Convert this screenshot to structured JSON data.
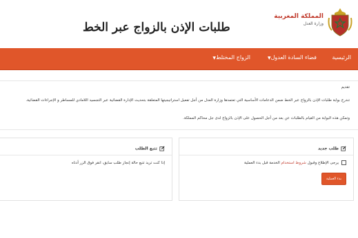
{
  "header": {
    "emblem_icon": "royal-emblem-icon",
    "kingdom_name": "المملكة المغربية",
    "ministry_name": "وزارة العدل",
    "site_title": "طلبات الإذن بالزواج عبر الخط"
  },
  "nav": {
    "color": "#e0562a",
    "items": [
      {
        "label": "الرئيسية",
        "has_dropdown": false
      },
      {
        "label": "فضاء السادة العدول",
        "has_dropdown": true
      },
      {
        "label": "الزواج المختلط",
        "has_dropdown": true
      }
    ]
  },
  "intro": {
    "heading": "تقديم",
    "paragraph1": "تندرج بوابة طلبات الإذن بالزواج عبر الخط ضمن الدعامات الأساسية التي تعتمدها وزارة العدل من أجل تفعيل استراتيجيتها المتعلقة بتحديث الإدارة القضائية عبر التجسيد اللامادي للمساطر و الإجراءات القضائية.",
    "paragraph2": "وتمكن هذه البوابة من القيام بالطلبات عن بعد من أجل الحصول على الإذن بالزواج لدى جل محاكم المملكة."
  },
  "new_request": {
    "title": "طلب جديد",
    "title_icon": "edit-icon",
    "checkbox_prefix": "يرجى الإطلاع وقبول",
    "checkbox_link": "شروط استخدام",
    "checkbox_suffix": "الخدمة قبل بدء العملية",
    "checked": false,
    "start_button": "بدء العملية"
  },
  "track_request": {
    "title": "تتبع الطلب",
    "title_icon": "edit-icon",
    "text": "إذا كنت تريد تتبع حالة إنجاز طلب سابق، انقر فوق الزر أدناه"
  }
}
